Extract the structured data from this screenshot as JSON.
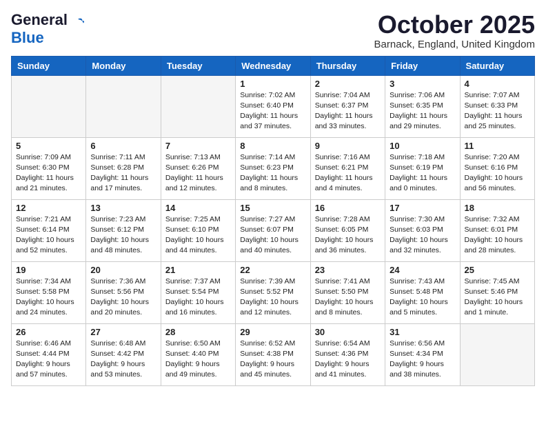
{
  "header": {
    "logo_general": "General",
    "logo_blue": "Blue",
    "month_title": "October 2025",
    "location": "Barnack, England, United Kingdom"
  },
  "days_of_week": [
    "Sunday",
    "Monday",
    "Tuesday",
    "Wednesday",
    "Thursday",
    "Friday",
    "Saturday"
  ],
  "weeks": [
    [
      {
        "day": "",
        "info": ""
      },
      {
        "day": "",
        "info": ""
      },
      {
        "day": "",
        "info": ""
      },
      {
        "day": "1",
        "info": "Sunrise: 7:02 AM\nSunset: 6:40 PM\nDaylight: 11 hours\nand 37 minutes."
      },
      {
        "day": "2",
        "info": "Sunrise: 7:04 AM\nSunset: 6:37 PM\nDaylight: 11 hours\nand 33 minutes."
      },
      {
        "day": "3",
        "info": "Sunrise: 7:06 AM\nSunset: 6:35 PM\nDaylight: 11 hours\nand 29 minutes."
      },
      {
        "day": "4",
        "info": "Sunrise: 7:07 AM\nSunset: 6:33 PM\nDaylight: 11 hours\nand 25 minutes."
      }
    ],
    [
      {
        "day": "5",
        "info": "Sunrise: 7:09 AM\nSunset: 6:30 PM\nDaylight: 11 hours\nand 21 minutes."
      },
      {
        "day": "6",
        "info": "Sunrise: 7:11 AM\nSunset: 6:28 PM\nDaylight: 11 hours\nand 17 minutes."
      },
      {
        "day": "7",
        "info": "Sunrise: 7:13 AM\nSunset: 6:26 PM\nDaylight: 11 hours\nand 12 minutes."
      },
      {
        "day": "8",
        "info": "Sunrise: 7:14 AM\nSunset: 6:23 PM\nDaylight: 11 hours\nand 8 minutes."
      },
      {
        "day": "9",
        "info": "Sunrise: 7:16 AM\nSunset: 6:21 PM\nDaylight: 11 hours\nand 4 minutes."
      },
      {
        "day": "10",
        "info": "Sunrise: 7:18 AM\nSunset: 6:19 PM\nDaylight: 11 hours\nand 0 minutes."
      },
      {
        "day": "11",
        "info": "Sunrise: 7:20 AM\nSunset: 6:16 PM\nDaylight: 10 hours\nand 56 minutes."
      }
    ],
    [
      {
        "day": "12",
        "info": "Sunrise: 7:21 AM\nSunset: 6:14 PM\nDaylight: 10 hours\nand 52 minutes."
      },
      {
        "day": "13",
        "info": "Sunrise: 7:23 AM\nSunset: 6:12 PM\nDaylight: 10 hours\nand 48 minutes."
      },
      {
        "day": "14",
        "info": "Sunrise: 7:25 AM\nSunset: 6:10 PM\nDaylight: 10 hours\nand 44 minutes."
      },
      {
        "day": "15",
        "info": "Sunrise: 7:27 AM\nSunset: 6:07 PM\nDaylight: 10 hours\nand 40 minutes."
      },
      {
        "day": "16",
        "info": "Sunrise: 7:28 AM\nSunset: 6:05 PM\nDaylight: 10 hours\nand 36 minutes."
      },
      {
        "day": "17",
        "info": "Sunrise: 7:30 AM\nSunset: 6:03 PM\nDaylight: 10 hours\nand 32 minutes."
      },
      {
        "day": "18",
        "info": "Sunrise: 7:32 AM\nSunset: 6:01 PM\nDaylight: 10 hours\nand 28 minutes."
      }
    ],
    [
      {
        "day": "19",
        "info": "Sunrise: 7:34 AM\nSunset: 5:58 PM\nDaylight: 10 hours\nand 24 minutes."
      },
      {
        "day": "20",
        "info": "Sunrise: 7:36 AM\nSunset: 5:56 PM\nDaylight: 10 hours\nand 20 minutes."
      },
      {
        "day": "21",
        "info": "Sunrise: 7:37 AM\nSunset: 5:54 PM\nDaylight: 10 hours\nand 16 minutes."
      },
      {
        "day": "22",
        "info": "Sunrise: 7:39 AM\nSunset: 5:52 PM\nDaylight: 10 hours\nand 12 minutes."
      },
      {
        "day": "23",
        "info": "Sunrise: 7:41 AM\nSunset: 5:50 PM\nDaylight: 10 hours\nand 8 minutes."
      },
      {
        "day": "24",
        "info": "Sunrise: 7:43 AM\nSunset: 5:48 PM\nDaylight: 10 hours\nand 5 minutes."
      },
      {
        "day": "25",
        "info": "Sunrise: 7:45 AM\nSunset: 5:46 PM\nDaylight: 10 hours\nand 1 minute."
      }
    ],
    [
      {
        "day": "26",
        "info": "Sunrise: 6:46 AM\nSunset: 4:44 PM\nDaylight: 9 hours\nand 57 minutes."
      },
      {
        "day": "27",
        "info": "Sunrise: 6:48 AM\nSunset: 4:42 PM\nDaylight: 9 hours\nand 53 minutes."
      },
      {
        "day": "28",
        "info": "Sunrise: 6:50 AM\nSunset: 4:40 PM\nDaylight: 9 hours\nand 49 minutes."
      },
      {
        "day": "29",
        "info": "Sunrise: 6:52 AM\nSunset: 4:38 PM\nDaylight: 9 hours\nand 45 minutes."
      },
      {
        "day": "30",
        "info": "Sunrise: 6:54 AM\nSunset: 4:36 PM\nDaylight: 9 hours\nand 41 minutes."
      },
      {
        "day": "31",
        "info": "Sunrise: 6:56 AM\nSunset: 4:34 PM\nDaylight: 9 hours\nand 38 minutes."
      },
      {
        "day": "",
        "info": ""
      }
    ]
  ]
}
